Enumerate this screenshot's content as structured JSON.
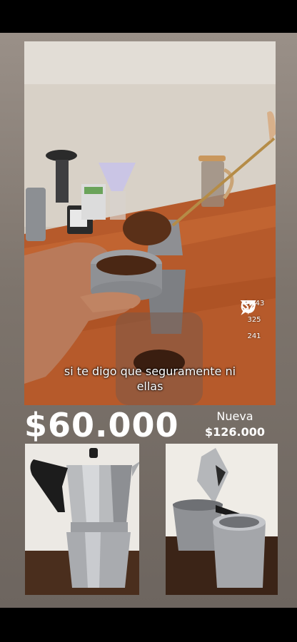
{
  "video": {
    "subtitle_line1": "si te digo que seguramente ni",
    "subtitle_line2": "ellas",
    "likes": "9.443",
    "comments": "325",
    "reposts": "241"
  },
  "listing": {
    "price": "$60.000",
    "new_label": "Nueva",
    "new_price": "$126.000"
  },
  "icons": [
    "heart-icon",
    "comment-icon",
    "repost-icon",
    "share-icon"
  ]
}
